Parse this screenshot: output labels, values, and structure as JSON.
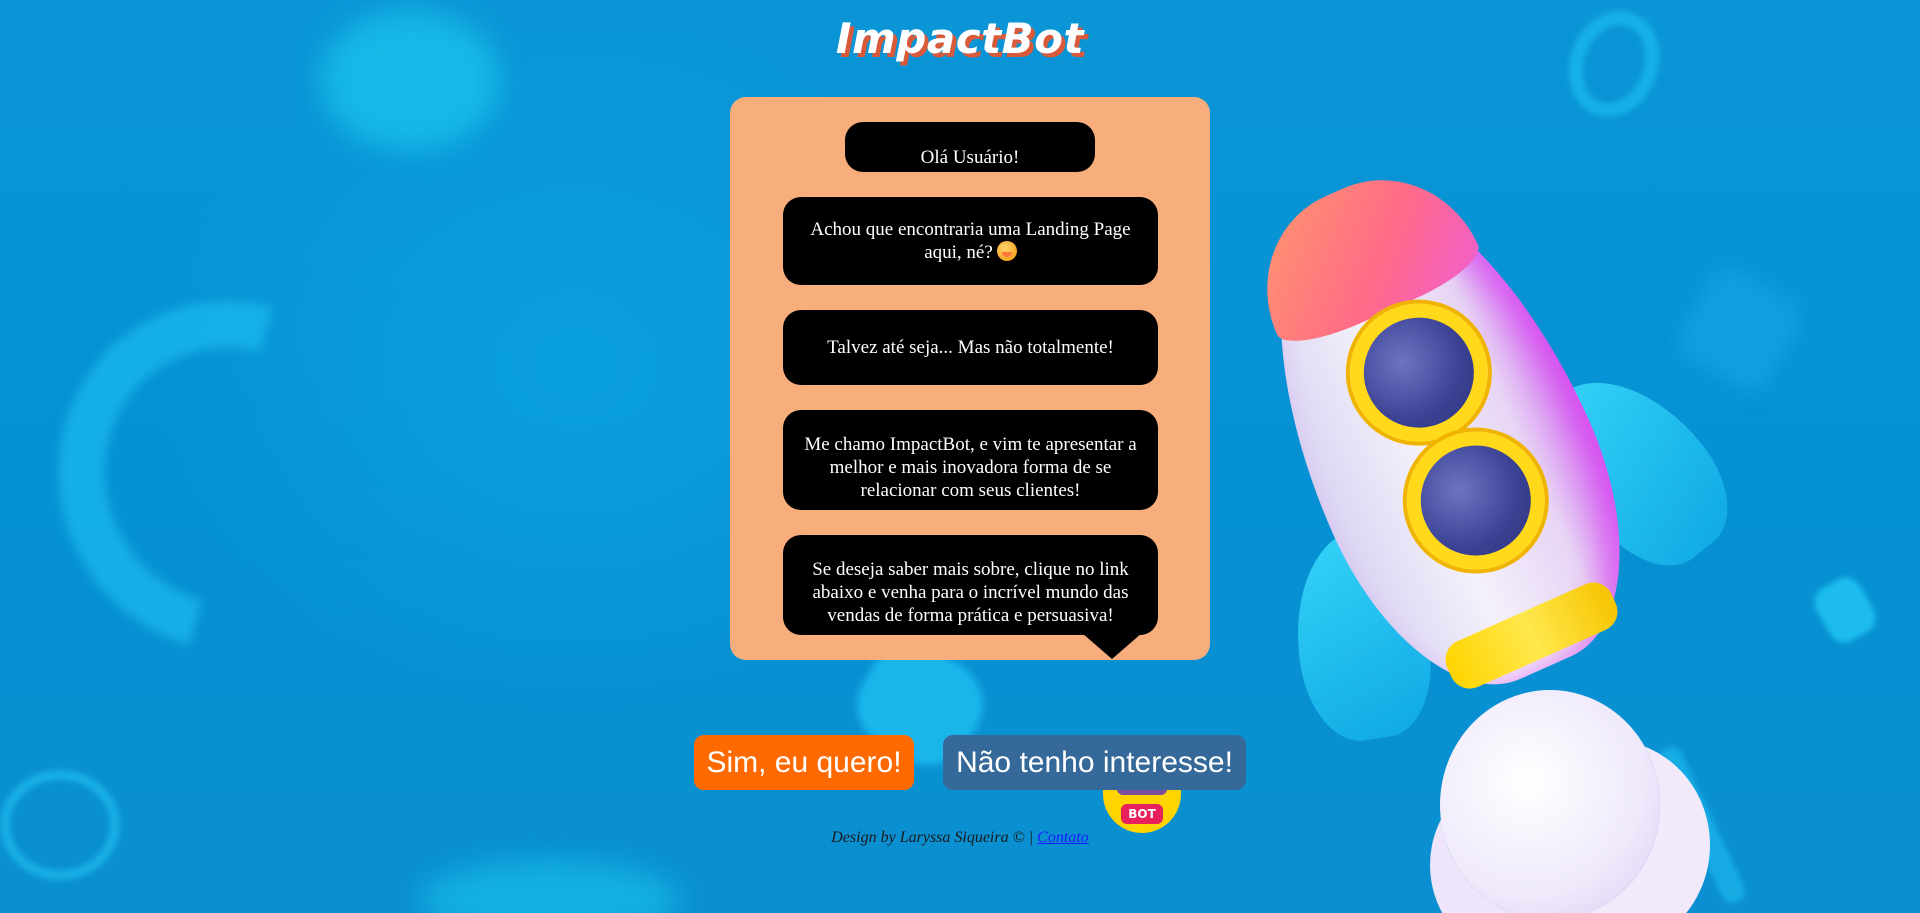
{
  "app": {
    "title": "ImpactBot"
  },
  "chat": {
    "messages": [
      "Olá Usuário!",
      "Achou que encontraria uma Landing Page aqui, né?",
      "Talvez até seja... Mas não totalmente!",
      "Me chamo ImpactBot, e vim te apresentar a melhor e mais inovadora forma de se relacionar com seus clientes!",
      "Se deseja saber mais sobre, clique no link abaixo e venha para o incrível mundo das vendas de forma prática e persuasiva!"
    ],
    "emoji_icon": "smiling-face-hand-over-mouth-icon"
  },
  "actions": {
    "yes_label": "Sim, eu quero!",
    "no_label": "Não tenho interesse!"
  },
  "bot_badge": {
    "label": "BOT"
  },
  "footer": {
    "credit": "Design by Laryssa Siqueira © |",
    "contact_label": "Contato"
  },
  "colors": {
    "background": "#0590d3",
    "card": "#f7ad7c",
    "bubble": "#000000",
    "yes_button": "#ff6a00",
    "no_button": "#356999",
    "title_shadow": "#d95a3a"
  }
}
